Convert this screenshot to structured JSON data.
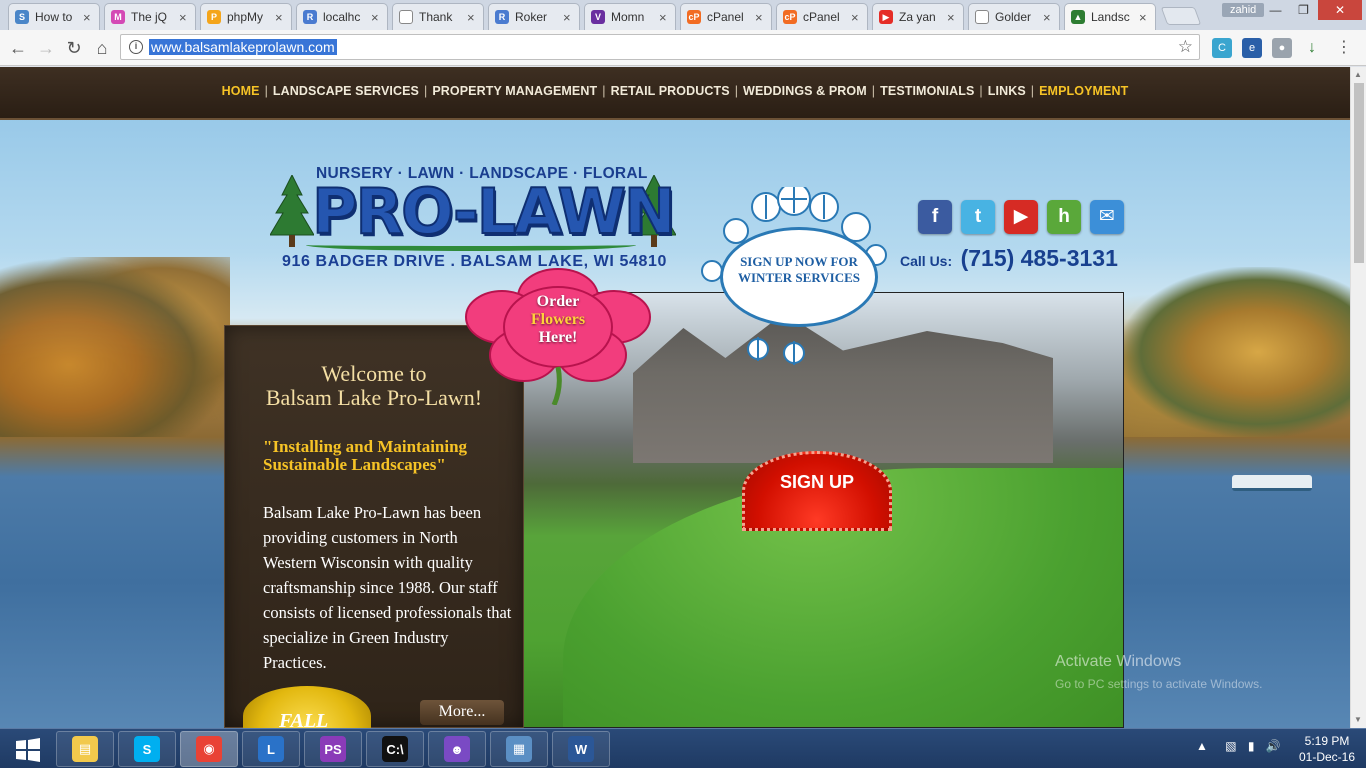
{
  "browser": {
    "tabs": [
      {
        "title": "How to",
        "favicon": "sc-icon",
        "color": "#4a86c8",
        "glyph": "S"
      },
      {
        "title": "The jQ",
        "favicon": "jq-icon",
        "color": "#d44ab5",
        "glyph": "M"
      },
      {
        "title": "phpMy",
        "favicon": "pma-icon",
        "color": "#f4a51b",
        "glyph": "P"
      },
      {
        "title": "localhc",
        "favicon": "roker-icon",
        "color": "#4a7bd0",
        "glyph": "R"
      },
      {
        "title": "Thank",
        "favicon": "doc-icon",
        "color": "#ffffff",
        "glyph": ""
      },
      {
        "title": "Roker",
        "favicon": "roker-icon",
        "color": "#4a7bd0",
        "glyph": "R"
      },
      {
        "title": "Momn",
        "favicon": "momn-icon",
        "color": "#6a2fa0",
        "glyph": "V"
      },
      {
        "title": "cPanel",
        "favicon": "cpanel-icon",
        "color": "#f26c23",
        "glyph": "cP"
      },
      {
        "title": "cPanel",
        "favicon": "cpanel-icon",
        "color": "#f26c23",
        "glyph": "cP"
      },
      {
        "title": "Za yan",
        "favicon": "youtube-icon",
        "color": "#e52d27",
        "glyph": "▶"
      },
      {
        "title": "Golder",
        "favicon": "doc-icon",
        "color": "#ffffff",
        "glyph": ""
      },
      {
        "title": "Landsc",
        "favicon": "tree-icon",
        "color": "#2e7d32",
        "glyph": "▲"
      }
    ],
    "user": "zahid",
    "url": "www.balsamlakeprolawn.com"
  },
  "site": {
    "nav": [
      {
        "label": "HOME",
        "highlight": true
      },
      {
        "label": "LANDSCAPE SERVICES",
        "highlight": false
      },
      {
        "label": "PROPERTY MANAGEMENT",
        "highlight": false
      },
      {
        "label": "RETAIL PRODUCTS",
        "highlight": false
      },
      {
        "label": "WEDDINGS & PROM",
        "highlight": false
      },
      {
        "label": "TESTIMONIALS",
        "highlight": false
      },
      {
        "label": "LINKS",
        "highlight": false
      },
      {
        "label": "EMPLOYMENT",
        "highlight": true
      }
    ],
    "logo": {
      "tagline": "NURSERY · LAWN · LANDSCAPE · FLORAL",
      "name": "PRO-LAWN",
      "address": "916 BADGER DRIVE . BALSAM LAKE, WI 54810"
    },
    "social": [
      {
        "name": "facebook-icon",
        "glyph": "f",
        "color": "#3b5ba0"
      },
      {
        "name": "twitter-icon",
        "glyph": "t",
        "color": "#48b3e3"
      },
      {
        "name": "youtube-icon",
        "glyph": "▶",
        "color": "#d62b24"
      },
      {
        "name": "houzz-icon",
        "glyph": "h",
        "color": "#5aa83a"
      },
      {
        "name": "email-icon",
        "glyph": "✉",
        "color": "#3c8fd8"
      }
    ],
    "call_label": "Call Us:",
    "phone": "(715) 485-3131",
    "winter_badge": "SIGN UP NOW FOR WINTER SERVICES",
    "flower_badge": {
      "line1": "Order",
      "line2": "Flowers",
      "line3": "Here!"
    },
    "welcome": {
      "title_line1": "Welcome to",
      "title_line2": "Balsam Lake Pro-Lawn!",
      "slogan": "\"Installing and Maintaining Sustainable Landscapes\"",
      "body": "Balsam Lake Pro-Lawn has been providing customers in North Western Wisconsin with quality craftsmanship since 1988. Our staff consists of licensed professionals that specialize in Green Industry Practices.",
      "more_label": "More...",
      "seal_text": "FALL"
    },
    "signup_label": "SIGN UP"
  },
  "watermark": {
    "line1": "Activate Windows",
    "line2": "Go to PC settings to activate Windows."
  },
  "taskbar": {
    "apps": [
      {
        "name": "file-explorer-icon",
        "glyph": "▤",
        "color": "#f2c94c"
      },
      {
        "name": "skype-icon",
        "glyph": "S",
        "color": "#00aff0"
      },
      {
        "name": "chrome-icon",
        "glyph": "◉",
        "color": "#e94235"
      },
      {
        "name": "lync-icon",
        "glyph": "L",
        "color": "#2a72c8"
      },
      {
        "name": "phpstorm-icon",
        "glyph": "PS",
        "color": "#8a3bb8"
      },
      {
        "name": "cmd-icon",
        "glyph": "C:\\",
        "color": "#111111"
      },
      {
        "name": "cat-app-icon",
        "glyph": "☻",
        "color": "#7a4ac4"
      },
      {
        "name": "network-app-icon",
        "glyph": "▦",
        "color": "#5b8fc4"
      },
      {
        "name": "word-icon",
        "glyph": "W",
        "color": "#2b5797"
      }
    ],
    "time": "5:19 PM",
    "date": "01-Dec-16"
  }
}
